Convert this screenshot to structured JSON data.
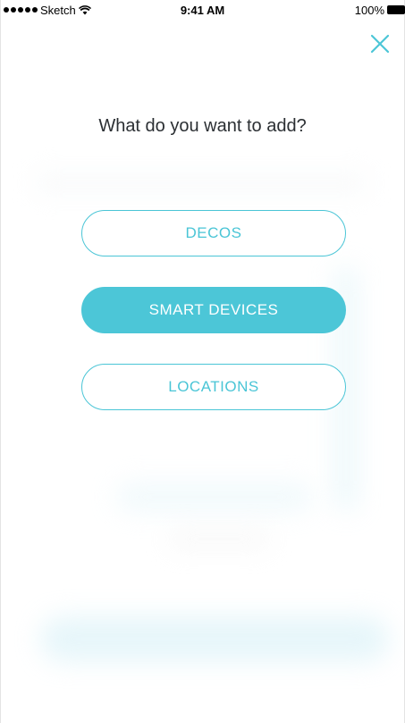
{
  "status_bar": {
    "carrier": "Sketch",
    "time": "9:41 AM",
    "battery": "100%"
  },
  "close_icon": "close-icon",
  "title": "What do you want to add?",
  "options": [
    {
      "label": "DECOS",
      "selected": false
    },
    {
      "label": "SMART DEVICES",
      "selected": true
    },
    {
      "label": "LOCATIONS",
      "selected": false
    }
  ],
  "colors": {
    "accent": "#4cc6d7",
    "title_text": "#2b2f33",
    "background": "#ffffff"
  }
}
